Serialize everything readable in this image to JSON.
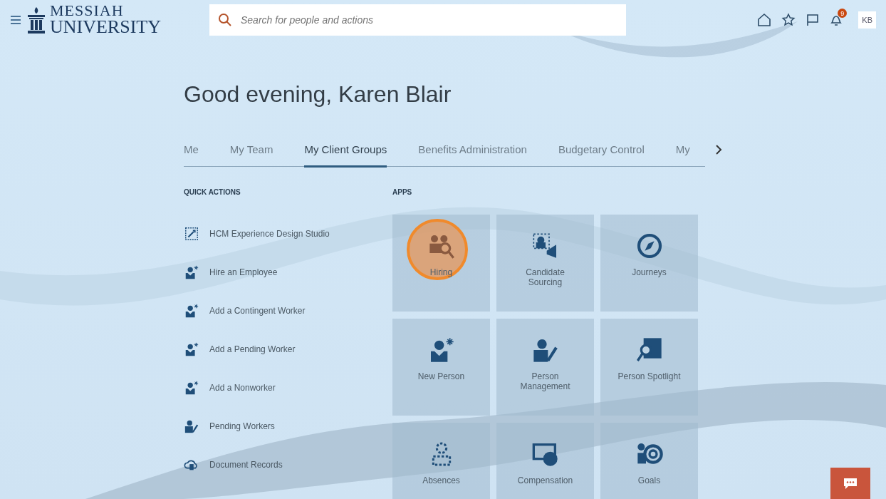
{
  "header": {
    "logo_line1": "MESSIAH",
    "logo_line2": "UNIVERSITY",
    "search": {
      "placeholder": "Search for people and actions"
    },
    "notification_count": "9",
    "avatar": "KB"
  },
  "greeting": "Good evening, Karen Blair",
  "tabs": [
    {
      "label": "Me",
      "selected": false
    },
    {
      "label": "My Team",
      "selected": false
    },
    {
      "label": "My Client Groups",
      "selected": true
    },
    {
      "label": "Benefits Administration",
      "selected": false
    },
    {
      "label": "Budgetary Control",
      "selected": false
    },
    {
      "label": "My",
      "selected": false
    }
  ],
  "quick_actions": {
    "title": "QUICK ACTIONS",
    "items": [
      {
        "label": "HCM Experience Design Studio",
        "kind": "studio"
      },
      {
        "label": "Hire an Employee",
        "kind": "add-person"
      },
      {
        "label": "Add a Contingent Worker",
        "kind": "add-person"
      },
      {
        "label": "Add a Pending Worker",
        "kind": "add-person"
      },
      {
        "label": "Add a Nonworker",
        "kind": "add-person"
      },
      {
        "label": "Pending Workers",
        "kind": "edit-person"
      },
      {
        "label": "Document Records",
        "kind": "cloud"
      }
    ]
  },
  "apps": {
    "title": "APPS",
    "tiles": [
      {
        "label": "Hiring",
        "kind": "hiring",
        "highlighted": true
      },
      {
        "label": "Candidate Sourcing",
        "kind": "sourcing",
        "highlighted": false
      },
      {
        "label": "Journeys",
        "kind": "compass",
        "highlighted": false
      },
      {
        "label": "New Person",
        "kind": "add-person",
        "highlighted": false
      },
      {
        "label": "Person Management",
        "kind": "edit-person",
        "highlighted": false
      },
      {
        "label": "Person Spotlight",
        "kind": "spotlight",
        "highlighted": false
      },
      {
        "label": "Absences",
        "kind": "absence",
        "highlighted": false
      },
      {
        "label": "Compensation",
        "kind": "compensation",
        "highlighted": false
      },
      {
        "label": "Goals",
        "kind": "goals",
        "highlighted": false
      }
    ]
  }
}
